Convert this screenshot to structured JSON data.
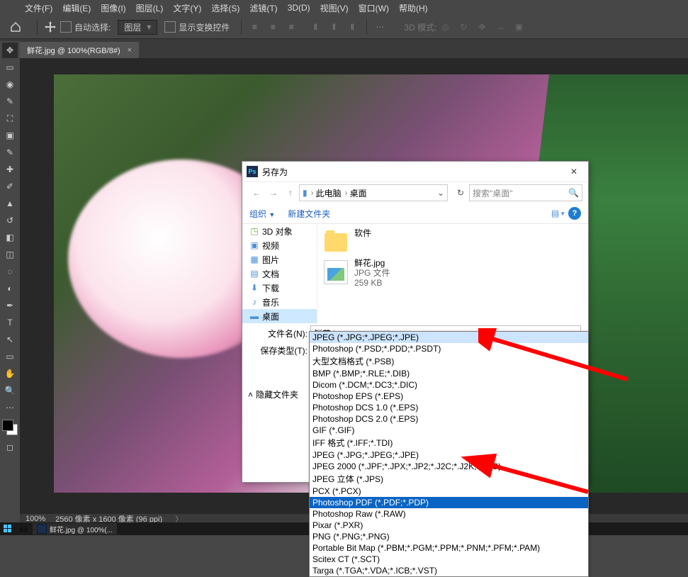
{
  "menubar": {
    "file": "文件(F)",
    "edit": "编辑(E)",
    "image": "图像(I)",
    "layer": "图层(L)",
    "type": "文字(Y)",
    "select": "选择(S)",
    "filter": "滤镜(T)",
    "threed": "3D(D)",
    "view": "视图(V)",
    "window": "窗口(W)",
    "help": "帮助(H)"
  },
  "optbar": {
    "auto_select": "自动选择:",
    "layer_combo": "图层",
    "show_transform": "显示变换控件",
    "mode3d": "3D 模式:"
  },
  "tab": {
    "title": "鲜花.jpg @ 100%(RGB/8#)"
  },
  "tree": {
    "obj3d": "3D 对象",
    "videos": "视频",
    "pictures": "图片",
    "documents": "文档",
    "downloads": "下载",
    "music": "音乐",
    "desktop": "桌面"
  },
  "dialog": {
    "title": "另存为",
    "path": {
      "pc": "此电脑",
      "desktop": "桌面"
    },
    "search_placeholder": "搜索\"桌面\"",
    "organize": "组织",
    "new_folder": "新建文件夹",
    "folder1": "软件",
    "file1": {
      "name": "鲜花.jpg",
      "type": "JPG 文件",
      "size": "259 KB"
    },
    "filename_label": "文件名(N):",
    "filename_value": "鲜花.jpg",
    "savetype_label": "保存类型(T):",
    "hide_folders": "隐藏文件夹"
  },
  "filetypes": [
    "JPEG (*.JPG;*.JPEG;*.JPE)",
    "Photoshop (*.PSD;*.PDD;*.PSDT)",
    "大型文档格式 (*.PSB)",
    "BMP (*.BMP;*.RLE;*.DIB)",
    "Dicom (*.DCM;*.DC3;*.DIC)",
    "Photoshop EPS (*.EPS)",
    "Photoshop DCS 1.0 (*.EPS)",
    "Photoshop DCS 2.0 (*.EPS)",
    "GIF (*.GIF)",
    "IFF 格式 (*.IFF;*.TDI)",
    "JPEG (*.JPG;*.JPEG;*.JPE)",
    "JPEG 2000 (*.JPF;*.JPX;*.JP2;*.J2C;*.J2K;*.JPC)",
    "JPEG 立体 (*.JPS)",
    "PCX (*.PCX)",
    "Photoshop PDF (*.PDF;*.PDP)",
    "Photoshop Raw (*.RAW)",
    "Pixar (*.PXR)",
    "PNG (*.PNG;*.PNG)",
    "Portable Bit Map (*.PBM;*.PGM;*.PPM;*.PNM;*.PFM;*.PAM)",
    "Scitex CT (*.SCT)",
    "Targa (*.TGA;*.VDA;*.ICB;*.VST)"
  ],
  "statusbar": {
    "zoom": "100%",
    "docsize": "2560 像素 x 1600 像素 (96 ppi)"
  },
  "taskbar": {
    "app": "鲜花.jpg @ 100%(..."
  }
}
